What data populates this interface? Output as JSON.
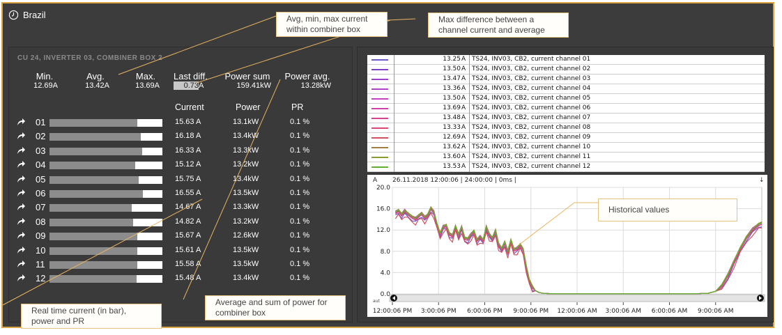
{
  "window": {
    "title": "Brazil"
  },
  "panel": {
    "title": "CU 24, INVERTER 03, COMBINER BOX 2",
    "stats": {
      "min_label": "Min.",
      "min_value": "12.69A",
      "avg_label": "Avg.",
      "avg_value": "13.42A",
      "max_label": "Max.",
      "max_value": "13.69A",
      "lastdiff_label": "Last diff.",
      "lastdiff_value": "0.73",
      "lastdiff_unit": "A",
      "powersum_label": "Power sum",
      "powersum_value": "159.41kW",
      "poweravg_label": "Power avg.",
      "poweravg_value": "13.28kW"
    },
    "headers": {
      "current": "Current",
      "power": "Power",
      "pr": "PR"
    },
    "channels": [
      {
        "id": "01",
        "current": "15.63 A",
        "power": "13.1kW",
        "pr": "0.1 %",
        "fill": 0.78
      },
      {
        "id": "02",
        "current": "16.18 A",
        "power": "13.4kW",
        "pr": "0.1 %",
        "fill": 0.81
      },
      {
        "id": "03",
        "current": "16.33 A",
        "power": "13.3kW",
        "pr": "0.1 %",
        "fill": 0.82
      },
      {
        "id": "04",
        "current": "15.12 A",
        "power": "13.2kW",
        "pr": "0.1 %",
        "fill": 0.76
      },
      {
        "id": "05",
        "current": "15.75 A",
        "power": "13.4kW",
        "pr": "0.1 %",
        "fill": 0.79
      },
      {
        "id": "06",
        "current": "16.55 A",
        "power": "13.5kW",
        "pr": "0.1 %",
        "fill": 0.83
      },
      {
        "id": "07",
        "current": "14.67 A",
        "power": "13.3kW",
        "pr": "0.1 %",
        "fill": 0.73
      },
      {
        "id": "08",
        "current": "14.82 A",
        "power": "13.2kW",
        "pr": "0.1 %",
        "fill": 0.74
      },
      {
        "id": "09",
        "current": "15.67 A",
        "power": "12.6kW",
        "pr": "0.1 %",
        "fill": 0.78
      },
      {
        "id": "10",
        "current": "15.61 A",
        "power": "13.5kW",
        "pr": "0.1 %",
        "fill": 0.78
      },
      {
        "id": "11",
        "current": "15.58 A",
        "power": "13.5kW",
        "pr": "0.1 %",
        "fill": 0.78
      },
      {
        "id": "12",
        "current": "15.48 A",
        "power": "13.4kW",
        "pr": "0.1 %",
        "fill": 0.77
      }
    ]
  },
  "legend": [
    {
      "value": "13.25",
      "unit": "A",
      "name": "TS24, INV03, CB2, current channel 01",
      "color": "#6a5acd"
    },
    {
      "value": "13.50",
      "unit": "A",
      "name": "TS24, INV03, CB2, current channel 02",
      "color": "#7b3fc8"
    },
    {
      "value": "13.47",
      "unit": "A",
      "name": "TS24, INV03, CB2, current channel 03",
      "color": "#9b40d0"
    },
    {
      "value": "13.36",
      "unit": "A",
      "name": "TS24, INV03, CB2, current channel 04",
      "color": "#b040c8"
    },
    {
      "value": "13.50",
      "unit": "A",
      "name": "TS24, INV03, CB2, current channel 05",
      "color": "#c840c0"
    },
    {
      "value": "13.69",
      "unit": "A",
      "name": "TS24, INV03, CB2, current channel 06",
      "color": "#d040a8"
    },
    {
      "value": "13.48",
      "unit": "A",
      "name": "TS24, INV03, CB2, current channel 07",
      "color": "#d84090"
    },
    {
      "value": "13.33",
      "unit": "A",
      "name": "TS24, INV03, CB2, current channel 08",
      "color": "#d84870"
    },
    {
      "value": "12.69",
      "unit": "A",
      "name": "TS24, INV03, CB2, current channel 09",
      "color": "#d05060"
    },
    {
      "value": "13.62",
      "unit": "A",
      "name": "TS24, INV03, CB2, current channel 10",
      "color": "#a08040"
    },
    {
      "value": "13.60",
      "unit": "A",
      "name": "TS24, INV03, CB2, current channel 11",
      "color": "#8a9a30"
    },
    {
      "value": "13.53",
      "unit": "A",
      "name": "TS24, INV03, CB2, current channel 12",
      "color": "#60b030"
    }
  ],
  "chart_data": {
    "type": "line",
    "unit_label": "A",
    "info": "26.11.2018 12:00:06 | 24:00:00 | 0ms |",
    "corner_label": "↓",
    "auto_label": "aut",
    "yticks": [
      "20.0",
      "16.0",
      "12.0",
      "8.0",
      "4.0",
      "0.0"
    ],
    "ylim": [
      0,
      20
    ],
    "xticks": [
      "12:00:06 PM",
      "3:00:06 PM",
      "6:00:06 PM",
      "9:00:06 PM",
      "12:00:06 AM",
      "3:00:06 AM",
      "6:00:06 AM",
      "9:00:06 AM"
    ],
    "xlim_hours": [
      0,
      24
    ],
    "base": {
      "x": [
        0.2,
        0.4,
        0.6,
        0.8,
        1.0,
        1.3,
        1.5,
        1.7,
        1.9,
        2.1,
        2.3,
        2.5,
        2.7,
        2.9,
        3.1,
        3.3,
        3.5,
        3.7,
        3.9,
        4.1,
        4.3,
        4.5,
        4.7,
        4.9,
        5.1,
        5.3,
        5.5,
        5.7,
        5.9,
        6.1,
        6.3,
        6.5,
        6.7,
        6.9,
        7.1,
        7.3,
        7.5,
        7.7,
        7.9,
        8.1,
        8.3,
        8.5,
        8.7,
        8.9,
        9.1,
        9.3,
        9.5,
        9.8,
        10.2,
        10.6,
        11,
        12,
        14,
        16,
        18,
        19.5,
        20.5,
        21,
        21.4,
        21.8,
        22.2,
        22.6,
        23,
        23.4,
        23.8,
        24
      ],
      "y": [
        15.2,
        15.6,
        14.8,
        15.5,
        15.0,
        14.3,
        14.0,
        14.6,
        15.0,
        14.2,
        14.8,
        16.0,
        15.2,
        13.0,
        11.2,
        12.5,
        12.8,
        11.2,
        10.8,
        12.6,
        11.0,
        12.4,
        10.4,
        10.2,
        11.0,
        11.7,
        10.0,
        10.6,
        10.0,
        12.5,
        11.0,
        10.4,
        11.8,
        9.2,
        8.4,
        9.6,
        7.8,
        10.0,
        8.2,
        8.4,
        9.2,
        8.2,
        5.0,
        2.5,
        1.2,
        0.6,
        0.3,
        0.1,
        0.05,
        0.03,
        0.02,
        0.02,
        0.02,
        0.02,
        0.02,
        0.02,
        0.1,
        0.5,
        1.5,
        3.5,
        6.0,
        8.5,
        10.5,
        12.0,
        13.0,
        13.2
      ]
    },
    "offsets": [
      -0.35,
      0.1,
      0.05,
      -0.1,
      0.08,
      0.22,
      0.06,
      -0.12,
      -0.6,
      0.18,
      0.16,
      0.1
    ]
  },
  "callouts": {
    "avg_min_max": "Avg, min, max current within combiner box",
    "max_diff": "Max difference between a channel current and average",
    "historical": "Historical values",
    "realtime": "Real time current (in bar), power and PR",
    "avg_sum_power": "Average and sum of power for combiner box"
  }
}
